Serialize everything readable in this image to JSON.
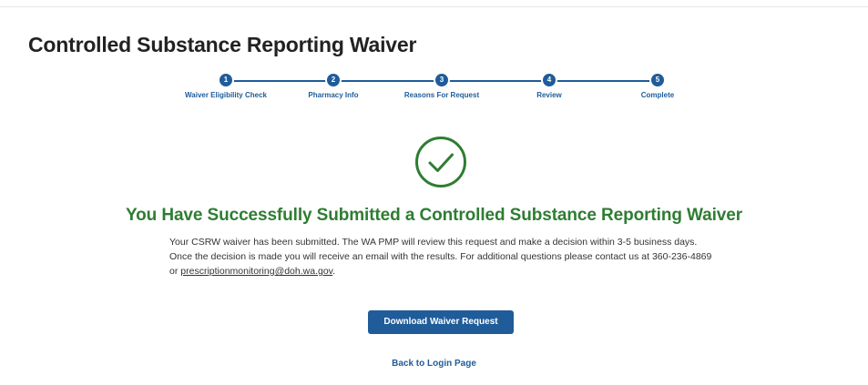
{
  "page": {
    "title": "Controlled Substance Reporting Waiver"
  },
  "stepper": {
    "color": "#1f5c99",
    "steps": [
      {
        "number": "1",
        "label": "Waiver Eligibility Check"
      },
      {
        "number": "2",
        "label": "Pharmacy Info"
      },
      {
        "number": "3",
        "label": "Reasons For Request"
      },
      {
        "number": "4",
        "label": "Review"
      },
      {
        "number": "5",
        "label": "Complete"
      }
    ]
  },
  "success": {
    "icon": "check-circle-icon",
    "color": "#2e7d32",
    "heading": "You Have Successfully Submitted a Controlled Substance Reporting Waiver",
    "message_part1": "Your CSRW waiver has been submitted. The WA PMP will review this request and make a decision within 3-5 business days. Once the decision is made you will receive an email with the results. For additional questions please contact us at 360-236-4869 or ",
    "email": "prescriptionmonitoring@doh.wa.gov",
    "message_end": "."
  },
  "actions": {
    "download_label": "Download Waiver Request",
    "back_label": "Back to Login Page"
  }
}
